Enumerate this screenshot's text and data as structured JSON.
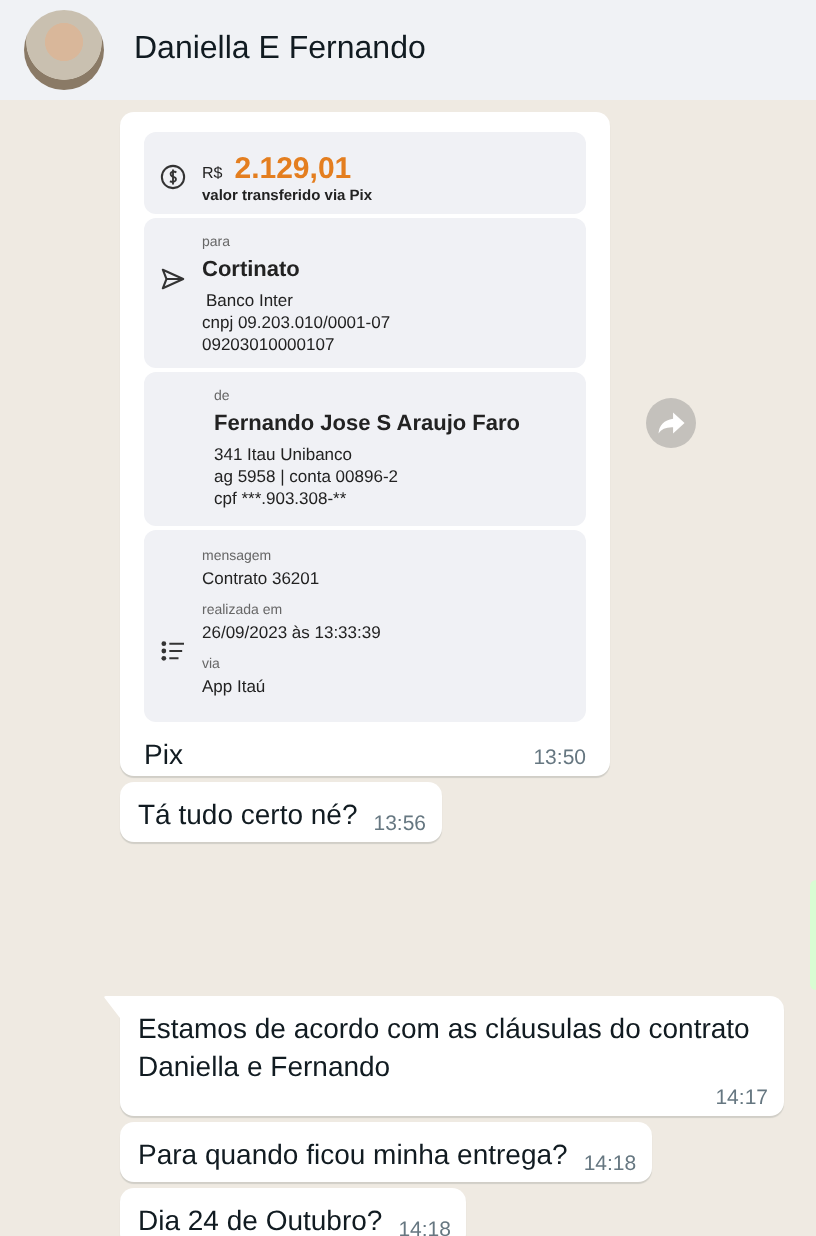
{
  "header": {
    "title": "Daniella E Fernando"
  },
  "image_message": {
    "receipt": {
      "currency": "R$",
      "amount": "2.129,01",
      "amount_label": "valor transferido via Pix",
      "to": {
        "label": "para",
        "name": "Cortinato",
        "lines": [
          "Banco Inter",
          "cnpj 09.203.010/0001-07",
          "09203010000107"
        ]
      },
      "from": {
        "label": "de",
        "name": "Fernando Jose S Araujo Faro",
        "lines": [
          "341 Itau Unibanco",
          "ag 5958 | conta 00896-2",
          "cpf ***.903.308-**"
        ]
      },
      "details": [
        {
          "label": "mensagem",
          "value": "Contrato 36201"
        },
        {
          "label": "realizada em",
          "value": "26/09/2023 às 13:33:39"
        },
        {
          "label": "via",
          "value": "App Itaú"
        }
      ]
    },
    "caption": "Pix",
    "time": "13:50"
  },
  "messages_before": [
    {
      "text": "Tá tudo certo né?",
      "time": "13:56",
      "tail": false
    }
  ],
  "messages_after": [
    {
      "text": "Estamos de acordo com as cláusulas do contrato Daniella e Fernando",
      "time": "14:17",
      "tail": true
    },
    {
      "text": "Para quando ficou minha entrega?",
      "time": "14:18",
      "tail": false
    },
    {
      "text": "Dia 24 de Outubro?",
      "time": "14:18",
      "tail": false
    }
  ]
}
